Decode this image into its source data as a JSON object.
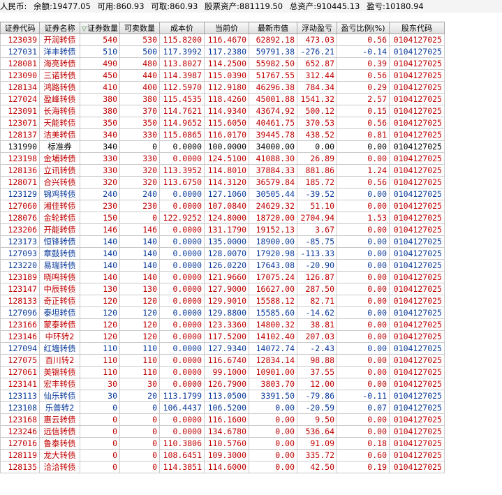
{
  "summary": {
    "currency": "人民币:",
    "balance_label": "余额:",
    "balance": "19477.05",
    "available_label": "可用:",
    "available": "860.93",
    "withdrawable_label": "可取:",
    "withdrawable": "860.93",
    "stock_assets_label": "股票资产:",
    "stock_assets": "881119.50",
    "total_assets_label": "总资产:",
    "total_assets": "910445.13",
    "pnl_label": "盈亏:",
    "pnl": "10180.94"
  },
  "columns": [
    "证券代码",
    "证券名称",
    "证券数量",
    "可卖数量",
    "成本价",
    "当前价",
    "最新市值",
    "浮动盈亏",
    "盈亏比例(%)",
    "股东代码"
  ],
  "colors": {
    "up": "#c00000",
    "down": "#0a3a9a",
    "flat": "#000000"
  },
  "rows": [
    {
      "code": "123039",
      "name": "开润转债",
      "qty": "540",
      "sell": "530",
      "cost": "115.8200",
      "price": "116.4670",
      "mv": "62892.18",
      "pl": "473.03",
      "pct": "0.56",
      "holder": "0104127025",
      "trend": "up"
    },
    {
      "code": "127031",
      "name": "洋丰转债",
      "qty": "510",
      "sell": "500",
      "cost": "117.3992",
      "price": "117.2380",
      "mv": "59791.38",
      "pl": "-276.21",
      "pct": "-0.14",
      "holder": "0104127025",
      "trend": "down"
    },
    {
      "code": "128081",
      "name": "海亮转债",
      "qty": "490",
      "sell": "480",
      "cost": "113.8027",
      "price": "114.2500",
      "mv": "55982.50",
      "pl": "652.87",
      "pct": "0.39",
      "holder": "0104127025",
      "trend": "up"
    },
    {
      "code": "123090",
      "name": "三诺转债",
      "qty": "450",
      "sell": "440",
      "cost": "114.3987",
      "price": "115.0390",
      "mv": "51767.55",
      "pl": "312.44",
      "pct": "0.56",
      "holder": "0104127025",
      "trend": "up"
    },
    {
      "code": "128134",
      "name": "鸿路转债",
      "qty": "410",
      "sell": "400",
      "cost": "112.5970",
      "price": "112.9180",
      "mv": "46296.38",
      "pl": "784.34",
      "pct": "0.29",
      "holder": "0104127025",
      "trend": "up"
    },
    {
      "code": "127024",
      "name": "盈峰转债",
      "qty": "380",
      "sell": "380",
      "cost": "115.4535",
      "price": "118.4260",
      "mv": "45001.88",
      "pl": "1541.32",
      "pct": "2.57",
      "holder": "0104127025",
      "trend": "up"
    },
    {
      "code": "123091",
      "name": "长海转债",
      "qty": "380",
      "sell": "370",
      "cost": "114.7621",
      "price": "114.9340",
      "mv": "43674.92",
      "pl": "500.12",
      "pct": "0.15",
      "holder": "0104127025",
      "trend": "up"
    },
    {
      "code": "123071",
      "name": "天能转债",
      "qty": "350",
      "sell": "350",
      "cost": "114.9652",
      "price": "115.6050",
      "mv": "40461.75",
      "pl": "370.53",
      "pct": "0.56",
      "holder": "0104127025",
      "trend": "up"
    },
    {
      "code": "128137",
      "name": "洁美转债",
      "qty": "340",
      "sell": "330",
      "cost": "115.0865",
      "price": "116.0170",
      "mv": "39445.78",
      "pl": "438.52",
      "pct": "0.81",
      "holder": "0104127025",
      "trend": "up"
    },
    {
      "code": "131990",
      "name": "标准券",
      "qty": "340",
      "sell": "0",
      "cost": "0.0000",
      "price": "100.0000",
      "mv": "34000.00",
      "pl": "0.00",
      "pct": "0.00",
      "holder": "0104127025",
      "trend": "flat"
    },
    {
      "code": "123198",
      "name": "金埔转债",
      "qty": "330",
      "sell": "330",
      "cost": "0.0000",
      "price": "124.5100",
      "mv": "41088.30",
      "pl": "26.89",
      "pct": "0.00",
      "holder": "0104127025",
      "trend": "up"
    },
    {
      "code": "128136",
      "name": "立讯转债",
      "qty": "330",
      "sell": "320",
      "cost": "113.3952",
      "price": "114.8010",
      "mv": "37884.33",
      "pl": "881.86",
      "pct": "1.24",
      "holder": "0104127025",
      "trend": "up"
    },
    {
      "code": "128071",
      "name": "合兴转债",
      "qty": "320",
      "sell": "320",
      "cost": "113.6750",
      "price": "114.3120",
      "mv": "36579.84",
      "pl": "185.72",
      "pct": "0.56",
      "holder": "0104127025",
      "trend": "up"
    },
    {
      "code": "123129",
      "name": "锦鸡转债",
      "qty": "240",
      "sell": "240",
      "cost": "0.0000",
      "price": "127.1060",
      "mv": "30505.44",
      "pl": "-39.52",
      "pct": "0.00",
      "holder": "0104127025",
      "trend": "down"
    },
    {
      "code": "127060",
      "name": "湘佳转债",
      "qty": "230",
      "sell": "230",
      "cost": "0.0000",
      "price": "107.0840",
      "mv": "24629.32",
      "pl": "51.10",
      "pct": "0.00",
      "holder": "0104127025",
      "trend": "up"
    },
    {
      "code": "128076",
      "name": "金轮转债",
      "qty": "150",
      "sell": "0",
      "cost": "122.9252",
      "price": "124.8000",
      "mv": "18720.00",
      "pl": "2704.94",
      "pct": "1.53",
      "holder": "0104127025",
      "trend": "up"
    },
    {
      "code": "123206",
      "name": "开能转债",
      "qty": "146",
      "sell": "146",
      "cost": "0.0000",
      "price": "131.1790",
      "mv": "19152.13",
      "pl": "3.67",
      "pct": "0.00",
      "holder": "0104127025",
      "trend": "up"
    },
    {
      "code": "123173",
      "name": "恒锋转债",
      "qty": "140",
      "sell": "140",
      "cost": "0.0000",
      "price": "135.0000",
      "mv": "18900.00",
      "pl": "-85.75",
      "pct": "0.00",
      "holder": "0104127025",
      "trend": "down"
    },
    {
      "code": "127093",
      "name": "章鼓转债",
      "qty": "140",
      "sell": "140",
      "cost": "0.0000",
      "price": "128.0070",
      "mv": "17920.98",
      "pl": "-113.33",
      "pct": "0.00",
      "holder": "0104127025",
      "trend": "down"
    },
    {
      "code": "123220",
      "name": "易瑞转债",
      "qty": "140",
      "sell": "140",
      "cost": "0.0000",
      "price": "126.0220",
      "mv": "17643.08",
      "pl": "-20.90",
      "pct": "0.00",
      "holder": "0104127025",
      "trend": "down"
    },
    {
      "code": "123189",
      "name": "晓鸣转债",
      "qty": "140",
      "sell": "140",
      "cost": "0.0000",
      "price": "121.9660",
      "mv": "17075.24",
      "pl": "126.87",
      "pct": "0.00",
      "holder": "0104127025",
      "trend": "up"
    },
    {
      "code": "123147",
      "name": "中辰转债",
      "qty": "130",
      "sell": "130",
      "cost": "0.0000",
      "price": "127.9000",
      "mv": "16627.00",
      "pl": "287.50",
      "pct": "0.00",
      "holder": "0104127025",
      "trend": "up"
    },
    {
      "code": "128133",
      "name": "奇正转债",
      "qty": "120",
      "sell": "120",
      "cost": "0.0000",
      "price": "129.9010",
      "mv": "15588.12",
      "pl": "82.71",
      "pct": "0.00",
      "holder": "0104127025",
      "trend": "up"
    },
    {
      "code": "127096",
      "name": "泰坦转债",
      "qty": "120",
      "sell": "120",
      "cost": "0.0000",
      "price": "129.8800",
      "mv": "15585.60",
      "pl": "-14.62",
      "pct": "0.00",
      "holder": "0104127025",
      "trend": "down"
    },
    {
      "code": "123166",
      "name": "蒙泰转债",
      "qty": "120",
      "sell": "120",
      "cost": "0.0000",
      "price": "123.3360",
      "mv": "14800.32",
      "pl": "38.81",
      "pct": "0.00",
      "holder": "0104127025",
      "trend": "up"
    },
    {
      "code": "123146",
      "name": "中环转2",
      "qty": "120",
      "sell": "120",
      "cost": "0.0000",
      "price": "117.5200",
      "mv": "14102.40",
      "pl": "207.03",
      "pct": "0.00",
      "holder": "0104127025",
      "trend": "up"
    },
    {
      "code": "127094",
      "name": "红墙转债",
      "qty": "110",
      "sell": "110",
      "cost": "0.0000",
      "price": "127.9340",
      "mv": "14072.74",
      "pl": "-2.43",
      "pct": "0.00",
      "holder": "0104127025",
      "trend": "down"
    },
    {
      "code": "127075",
      "name": "百川转2",
      "qty": "110",
      "sell": "110",
      "cost": "0.0000",
      "price": "116.6740",
      "mv": "12834.14",
      "pl": "98.88",
      "pct": "0.00",
      "holder": "0104127025",
      "trend": "up"
    },
    {
      "code": "127061",
      "name": "美锦转债",
      "qty": "110",
      "sell": "110",
      "cost": "0.0000",
      "price": "99.1000",
      "mv": "10901.00",
      "pl": "37.55",
      "pct": "0.00",
      "holder": "0104127025",
      "trend": "up"
    },
    {
      "code": "123141",
      "name": "宏丰转债",
      "qty": "30",
      "sell": "30",
      "cost": "0.0000",
      "price": "126.7900",
      "mv": "3803.70",
      "pl": "12.00",
      "pct": "0.00",
      "holder": "0104127025",
      "trend": "up"
    },
    {
      "code": "123113",
      "name": "仙乐转债",
      "qty": "30",
      "sell": "20",
      "cost": "113.1799",
      "price": "113.0500",
      "mv": "3391.50",
      "pl": "-79.86",
      "pct": "-0.11",
      "holder": "0104127025",
      "trend": "down"
    },
    {
      "code": "123108",
      "name": "乐普转2",
      "qty": "0",
      "sell": "0",
      "cost": "106.4437",
      "price": "106.5200",
      "mv": "0.00",
      "pl": "-20.59",
      "pct": "0.07",
      "holder": "0104127025",
      "trend": "down"
    },
    {
      "code": "123168",
      "name": "惠云转债",
      "qty": "0",
      "sell": "0",
      "cost": "0.0000",
      "price": "116.1600",
      "mv": "0.00",
      "pl": "9.50",
      "pct": "0.00",
      "holder": "0104127025",
      "trend": "up"
    },
    {
      "code": "123246",
      "name": "远信转债",
      "qty": "0",
      "sell": "0",
      "cost": "0.0000",
      "price": "134.6780",
      "mv": "0.00",
      "pl": "536.64",
      "pct": "0.00",
      "holder": "0104127025",
      "trend": "up"
    },
    {
      "code": "127016",
      "name": "鲁泰转债",
      "qty": "0",
      "sell": "0",
      "cost": "110.3806",
      "price": "110.5760",
      "mv": "0.00",
      "pl": "91.09",
      "pct": "0.18",
      "holder": "0104127025",
      "trend": "up"
    },
    {
      "code": "128119",
      "name": "龙大转债",
      "qty": "0",
      "sell": "0",
      "cost": "108.6451",
      "price": "109.3000",
      "mv": "0.00",
      "pl": "335.72",
      "pct": "0.60",
      "holder": "0104127025",
      "trend": "up"
    },
    {
      "code": "128135",
      "name": "洽洽转债",
      "qty": "0",
      "sell": "0",
      "cost": "114.3851",
      "price": "114.6000",
      "mv": "0.00",
      "pl": "42.50",
      "pct": "0.19",
      "holder": "0104127025",
      "trend": "up"
    }
  ]
}
